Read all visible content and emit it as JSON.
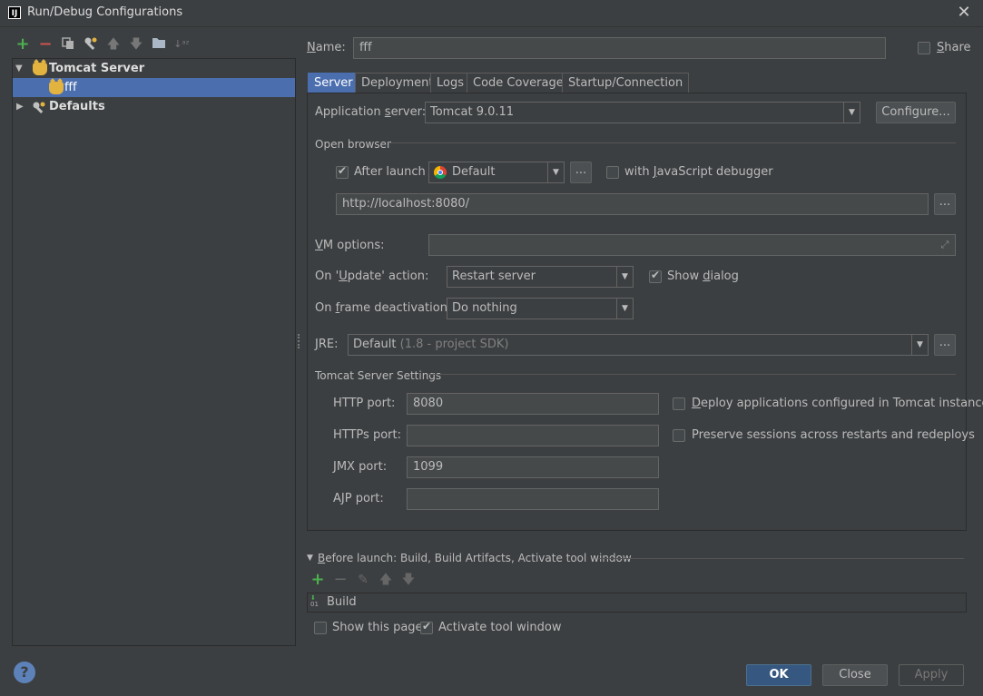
{
  "window": {
    "title": "Run/Debug Configurations",
    "app_icon": "IJ"
  },
  "toolbar": {
    "icons": [
      "add-icon",
      "remove-icon",
      "copy-icon",
      "edit-defaults-icon",
      "move-up-icon",
      "move-down-icon",
      "folder-icon",
      "sort-icon"
    ],
    "colors": {
      "add": "#4caf50",
      "remove": "#c75450"
    }
  },
  "tree": {
    "tomcat_label": "Tomcat Server",
    "fff_label": "fff",
    "defaults_label": "Defaults"
  },
  "name_row": {
    "label_pre": "",
    "label_u": "N",
    "label_post": "ame:",
    "value": "fff",
    "share_label": "Share",
    "share_u": "S",
    "share_rest": "hare"
  },
  "tabs": [
    "Server",
    "Deployment",
    "Logs",
    "Code Coverage",
    "Startup/Connection"
  ],
  "server": {
    "app_server_label_pre": "Application ",
    "app_server_label_u": "s",
    "app_server_label_post": "erver:",
    "app_server_value": "Tomcat 9.0.11",
    "configure_label": "Configure...",
    "open_browser_title": "Open browser",
    "after_launch_label": "After launch",
    "after_launch_checked": true,
    "browser_value": "Default",
    "ellipsis": "...",
    "js_debugger_label_pre": "with ",
    "js_debugger_label_u": "J",
    "js_debugger_label_post": "avaScript debugger",
    "url_value": "http://localhost:8080/",
    "vm_options_label_u": "V",
    "vm_options_label_post": "M options:",
    "vm_options_value": "",
    "on_update_label_pre": "On '",
    "on_update_label_u": "U",
    "on_update_label_post": "pdate' action:",
    "on_update_value": "Restart server",
    "show_dialog_label_pre": "Show ",
    "show_dialog_label_u": "d",
    "show_dialog_label_post": "ialog",
    "show_dialog_checked": true,
    "frame_deact_label_pre": "On ",
    "frame_deact_label_u": "f",
    "frame_deact_label_post": "rame deactivation:",
    "frame_deact_value": "Do nothing",
    "jre_label_u": "J",
    "jre_label_post": "RE:",
    "jre_value": "Default",
    "jre_hint": "(1.8 - project SDK)",
    "tomcat_settings_title": "Tomcat Server Settings",
    "http_port_label": "HTTP port:",
    "http_port_value": "8080",
    "https_port_label": "HTTPs port:",
    "https_port_value": "",
    "jmx_port_label": "JMX port:",
    "jmx_port_value": "1099",
    "ajp_port_label": "AJP port:",
    "ajp_port_value": "",
    "deploy_apps_label": "Deploy applications configured in Tomcat instance",
    "deploy_apps_u": "D",
    "deploy_apps_rest": "eploy applications configured in Tomcat instance",
    "preserve_sessions_label": "Preserve sessions across restarts and redeploys"
  },
  "before_launch": {
    "title_u": "B",
    "title_rest": "efore launch: Build, Build Artifacts, Activate tool window",
    "item": "Build",
    "show_page_label": "Show this page",
    "activate_label": "Activate tool window",
    "activate_checked": true
  },
  "buttons": {
    "ok": "OK",
    "close": "Close",
    "apply": "Apply",
    "help": "?"
  },
  "colors": {
    "accent": "#4b6eaf",
    "background": "#3c3f41",
    "ok_button": "#365880"
  }
}
